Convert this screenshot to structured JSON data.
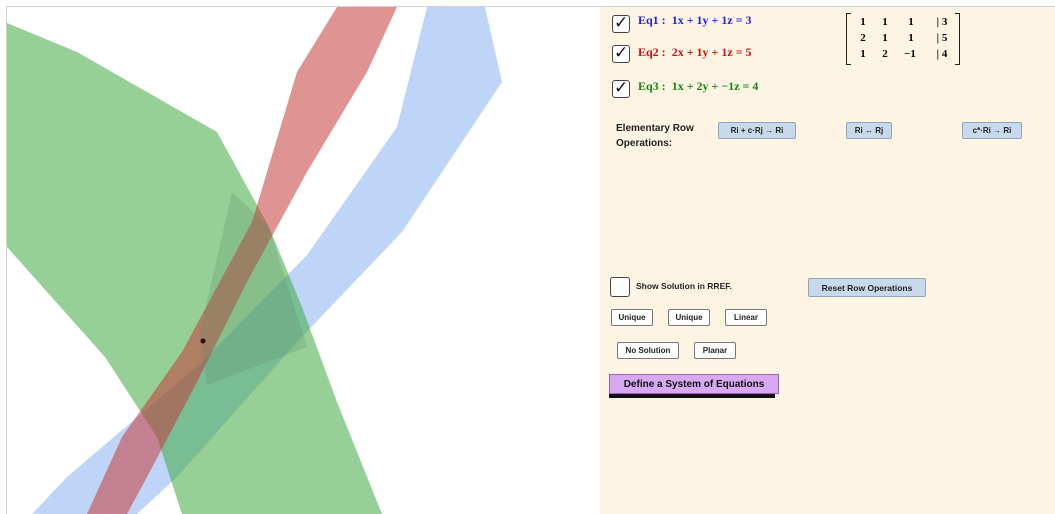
{
  "equations": [
    {
      "label": "Eq1 :",
      "expr": "1x + 1y + 1z = 3",
      "checked": true,
      "color": "#2222dd"
    },
    {
      "label": "Eq2 :",
      "expr": "2x + 1y + 1z = 5",
      "checked": true,
      "color": "#cc1111"
    },
    {
      "label": "Eq3 :",
      "expr": "1x + 2y + −1z = 4",
      "checked": true,
      "color": "#118811"
    }
  ],
  "matrix": {
    "rows": [
      [
        "1",
        "1",
        "1",
        "| 3"
      ],
      [
        "2",
        "1",
        "1",
        "| 5"
      ],
      [
        "1",
        "2",
        "−1",
        "| 4"
      ]
    ]
  },
  "row_ops": {
    "label": "Elementary Row Operations:",
    "buttons": [
      "Ri + c·Rj → Ri",
      "Ri ↔ Rj",
      "c*·Ri → Ri"
    ]
  },
  "show_solution": {
    "label": "Show Solution in RREF.",
    "checked": false
  },
  "reset_button": "Reset Row Operations",
  "type_buttons": [
    "Unique",
    "Unique",
    "Linear",
    "No Solution",
    "Planar"
  ],
  "define_button": "Define a System of Equations",
  "plane_colors": {
    "eq1": "#7aa7f0",
    "eq2": "#c43a3a",
    "eq3": "#3faa3f"
  }
}
